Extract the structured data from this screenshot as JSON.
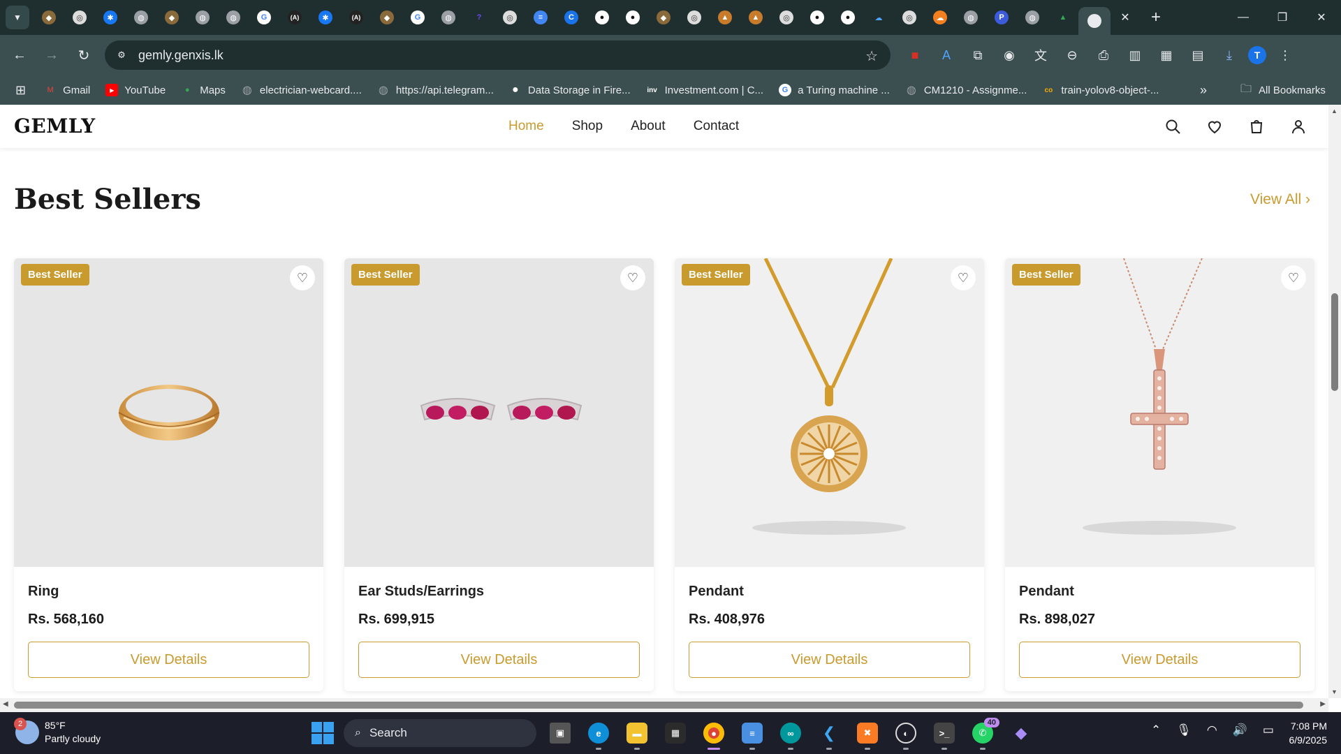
{
  "browser": {
    "url": "gemly.genxis.lk",
    "bookmarks": [
      {
        "label": "Gmail",
        "color": "#ea4335",
        "glyph": "M"
      },
      {
        "label": "YouTube",
        "color": "#ff0000",
        "glyph": "▶"
      },
      {
        "label": "Maps",
        "color": "#34a853",
        "glyph": "●"
      },
      {
        "label": "electrician-webcard....",
        "color": "#9aa0a6",
        "glyph": "◍"
      },
      {
        "label": "https://api.telegram...",
        "color": "#9aa0a6",
        "glyph": "◍"
      },
      {
        "label": "Data Storage in Fire...",
        "color": "#ffffff",
        "glyph": "●"
      },
      {
        "label": "Investment.com | C...",
        "color": "#ffffff",
        "glyph": "inv"
      },
      {
        "label": "a Turing machine ...",
        "color": "#4285f4",
        "glyph": "G"
      },
      {
        "label": "CM1210 - Assignme...",
        "color": "#9aa0a6",
        "glyph": "◍"
      },
      {
        "label": "train-yolov8-object-...",
        "color": "#f9ab00",
        "glyph": "co"
      }
    ],
    "all_bookmarks_label": "All Bookmarks",
    "profile_initial": "T"
  },
  "site": {
    "logo": "GEMLY",
    "nav": [
      "Home",
      "Shop",
      "About",
      "Contact"
    ],
    "active_nav": "Home",
    "accent": "#c99a2e"
  },
  "section": {
    "title": "Best Sellers",
    "view_all": "View All ›"
  },
  "products": [
    {
      "name": "Ring",
      "price": "Rs. 568,160",
      "badge": "Best Seller",
      "button": "View Details",
      "image": "ring"
    },
    {
      "name": "Ear Studs/Earrings",
      "price": "Rs. 699,915",
      "badge": "Best Seller",
      "button": "View Details",
      "image": "earrings"
    },
    {
      "name": "Pendant",
      "price": "Rs. 408,976",
      "badge": "Best Seller",
      "button": "View Details",
      "image": "gold-pendant"
    },
    {
      "name": "Pendant",
      "price": "Rs. 898,027",
      "badge": "Best Seller",
      "button": "View Details",
      "image": "cross-pendant"
    }
  ],
  "taskbar": {
    "weather_temp": "85°F",
    "weather_desc": "Partly cloudy",
    "weather_badge": "2",
    "search_label": "Search",
    "whatsapp_badge": "40",
    "time": "7:08 PM",
    "date": "6/9/2025"
  }
}
